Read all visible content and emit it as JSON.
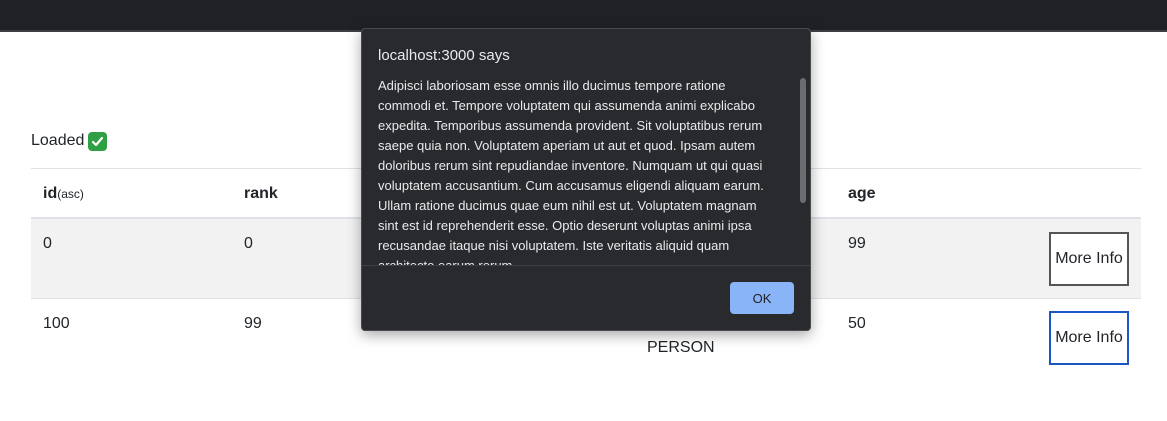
{
  "status": {
    "text": "Loaded",
    "icon": "check-mark-icon",
    "icon_color": "#2ea043"
  },
  "table": {
    "headers": {
      "id": "id",
      "id_sort": "(asc)",
      "rank": "rank",
      "age": "age"
    },
    "rows": [
      {
        "id": "0",
        "rank": "0",
        "type": "",
        "age": "99",
        "button": "More Info"
      },
      {
        "id": "100",
        "rank": "99",
        "type": "PERSON",
        "age": "50",
        "button": "More Info"
      }
    ]
  },
  "dialog": {
    "title": "localhost:3000 says",
    "message": "Adipisci laboriosam esse omnis illo ducimus tempore ratione commodi et. Tempore voluptatem qui assumenda animi explicabo expedita. Temporibus assumenda provident. Sit voluptatibus rerum saepe quia non. Voluptatem aperiam ut aut et quod. Ipsam autem doloribus rerum sint repudiandae inventore. Numquam ut qui quasi voluptatem accusantium. Cum accusamus eligendi aliquam earum. Ullam ratione ducimus quae eum nihil est ut. Voluptatem magnam sint est id reprehenderit esse. Optio deserunt voluptas animi ipsa recusandae itaque nisi voluptatem. Iste veritatis aliquid quam architecto earum rerum.",
    "ok_label": "OK",
    "ok_color": "#8ab4f8",
    "background": "#292a2d"
  }
}
